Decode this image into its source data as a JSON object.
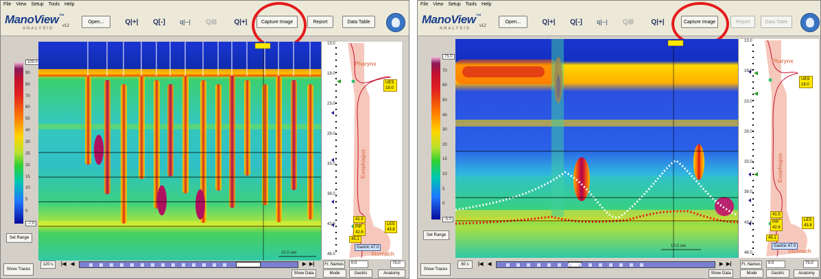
{
  "left": {
    "menu": [
      "File",
      "View",
      "Setup",
      "Tools",
      "Help"
    ],
    "logo": "ManoView",
    "logo_sub": "ANALYSIS",
    "version": "v1.2",
    "toolbar": {
      "open": "Open...",
      "capture": "Capture Image",
      "report": "Report",
      "data_table": "Data Table"
    },
    "scale_ticks": [
      "100.0",
      "90",
      "80",
      "70",
      "60",
      "50",
      "40",
      "30",
      "25",
      "20",
      "15",
      "10",
      "5",
      "0",
      "-7.0"
    ],
    "ruler_numbers": [
      "13.0",
      "18.0",
      "23.0",
      "28.0",
      "33.0",
      "38.0",
      "43.0",
      "48.0"
    ],
    "anatomy": {
      "pharynx": "Pharynx",
      "esophagus": "Esophagus",
      "stomach": "Stomach"
    },
    "markers": {
      "ues": "UES 19.0",
      "pip": "PIP 42.6",
      "les": "LES 43.8",
      "m415": "41.5",
      "m451": "45.1",
      "gastric": "Gastric 47.0"
    },
    "time_label": "10.0 sec",
    "footer": {
      "set_range": "Set Range",
      "show_traces": "Show Traces",
      "interval": "120 s",
      "fr_names": "Fr. Names",
      "field1": "0.0",
      "field2": "75.0",
      "show_data": "Show Data",
      "mode": "Mode",
      "gastric": "Gastric",
      "anatomy": "Anatomy"
    }
  },
  "right": {
    "menu": [
      "File",
      "View",
      "Setup",
      "Tools",
      "Help"
    ],
    "logo": "ManoView",
    "logo_sub": "ANALYSIS",
    "version": "v1.2",
    "toolbar": {
      "open": "Open...",
      "capture": "Capture Image",
      "report": "Report",
      "data_table": "Data Table"
    },
    "scale_ticks": [
      "75.0",
      "70",
      "60",
      "50",
      "40",
      "30",
      "20",
      "15",
      "10",
      "5",
      "0",
      "-5.0"
    ],
    "ruler_numbers": [
      "13.0",
      "18.0",
      "23.0",
      "28.0",
      "33.0",
      "38.0",
      "43.0",
      "48.0"
    ],
    "anatomy": {
      "pharynx": "Pharynx",
      "esophagus": "Esophagus",
      "stomach": "Stomach"
    },
    "markers": {
      "ues": "UES 19.0",
      "pip": "PIP 42.6",
      "les": "LES 43.8",
      "m415": "41.5",
      "m451": "45.1",
      "gastric": "Gastric 47.0"
    },
    "time_label": "10.0 sec",
    "footer": {
      "set_range": "Set Range",
      "show_traces": "Show Traces",
      "interval": "60 s",
      "fr_names": "Fr. Names",
      "field1": "0.0",
      "field2": "75.0",
      "show_data": "Show Data",
      "mode": "Mode",
      "gastric": "Gastric",
      "anatomy": "Anatomy"
    }
  },
  "colors": {
    "highlight": "#e41b1b",
    "logo": "#1c3f8a",
    "window": "#d4d0c8",
    "toolbar": "#ece9d8"
  },
  "icons": [
    "zoom-in-both-icon",
    "zoom-in-x-icon",
    "zoom-out-icon",
    "zoom-box-icon",
    "zoom-y-icon",
    "mascot-icon"
  ]
}
